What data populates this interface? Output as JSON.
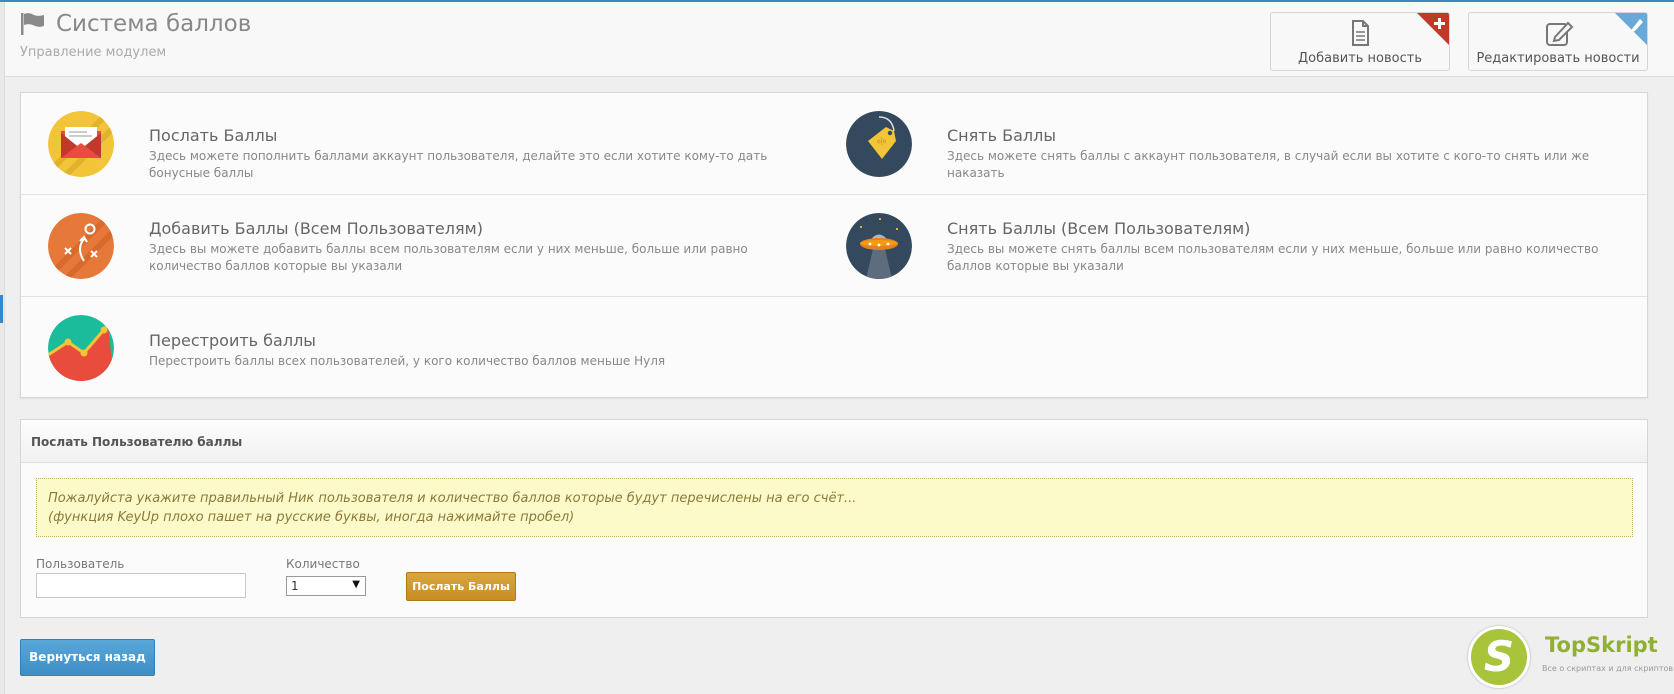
{
  "header": {
    "title": "Система баллов",
    "subtitle": "Управление модулем",
    "add_news": "Добавить новость",
    "edit_news": "Редактировать новости"
  },
  "actions": [
    {
      "title": "Послать Баллы",
      "desc": "Здесь можете пополнить баллами аккаунт пользователя, делайте это если хотите кому-то дать бонусные баллы",
      "icon": "envelope-icon"
    },
    {
      "title": "Снять Баллы",
      "desc": "Здесь можете снять баллы с аккаунт пользователя, в случай если вы хотите с кого-то снять или же наказать",
      "icon": "price-tag-icon"
    },
    {
      "title": "Добавить Баллы (Всем Пользователям)",
      "desc": "Здесь вы можете добавить баллы всем пользователям если у них меньше, больше или равно количество баллов которые вы указали",
      "icon": "strategy-board-icon"
    },
    {
      "title": "Снять Баллы (Всем Пользователям)",
      "desc": "Здесь вы можете снять баллы всем пользователям если у них меньше, больше или равно количество баллов которые вы указали",
      "icon": "ufo-icon"
    },
    {
      "title": "Перестроить баллы",
      "desc": "Перестроить баллы всех пользователей, у кого количество баллов меньше Нуля",
      "icon": "line-chart-icon"
    }
  ],
  "send_form": {
    "heading": "Послать Пользователю баллы",
    "notice_line1": "Пожалуйста укажите правильный Ник пользователя и количество баллов которые будут перечислены на его счёт...",
    "notice_line2": "(функция KeyUp плохо пашет на русские буквы, иногда нажимайте пробел)",
    "user_label": "Пользователь",
    "user_value": "",
    "qty_label": "Количество",
    "qty_value": "1",
    "submit_label": "Послать Баллы"
  },
  "back_label": "Вернуться назад",
  "watermark": {
    "letter": "S",
    "name": "TopSkript",
    "tagline": "Все о скриптах и для скриптов..."
  },
  "colors": {
    "accent_blue": "#3a87c8",
    "gold_button": "#d29a32",
    "notice_bg": "#fdfac9",
    "add_corner": "#c0392b",
    "edit_corner": "#6aa8d8"
  }
}
